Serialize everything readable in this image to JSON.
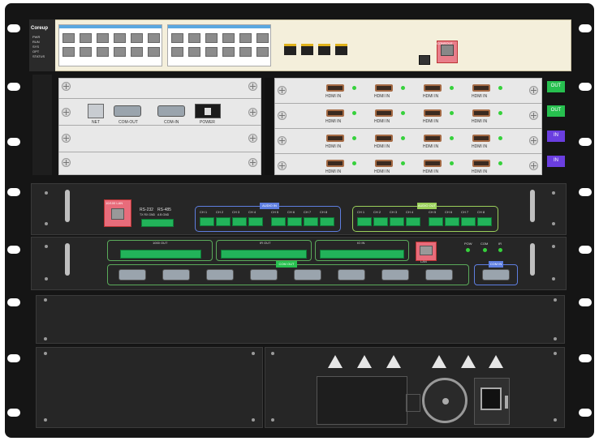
{
  "brand": "Coreup",
  "front_leds": [
    "PWR",
    "RUN",
    "SYS",
    "OPT",
    "STATUS"
  ],
  "console_label": "CONSOLE",
  "ctrl_card": {
    "net": "NET",
    "com_out": "COM-OUT",
    "com_in": "COM-IN",
    "power": "POWER"
  },
  "hdmi_label": "HDMI IN",
  "side_tags": [
    "OUT",
    "OUT",
    "IN",
    "IN"
  ],
  "audio": {
    "lan_label": "10/100 LAN",
    "rs232": "RS-232",
    "rs485": "RS-485",
    "sub1": "TX RX GND",
    "sub2": "A B GND",
    "group1": "AUDIO IN",
    "group2": "AUDIO OUT",
    "channels": [
      "CH 1",
      "CH 2",
      "CH 3",
      "CH 4",
      "CH 5",
      "CH 6",
      "CH 7",
      "CH 8"
    ]
  },
  "ctrl": {
    "relay": "1000 OUT",
    "ir": "IR OUT",
    "io": "IO IN",
    "lan": "LAN",
    "pow": "POW",
    "com": "COM",
    "ir_lbl": "IR",
    "com_ch": "COM OUT",
    "com_in": "COM IN"
  }
}
